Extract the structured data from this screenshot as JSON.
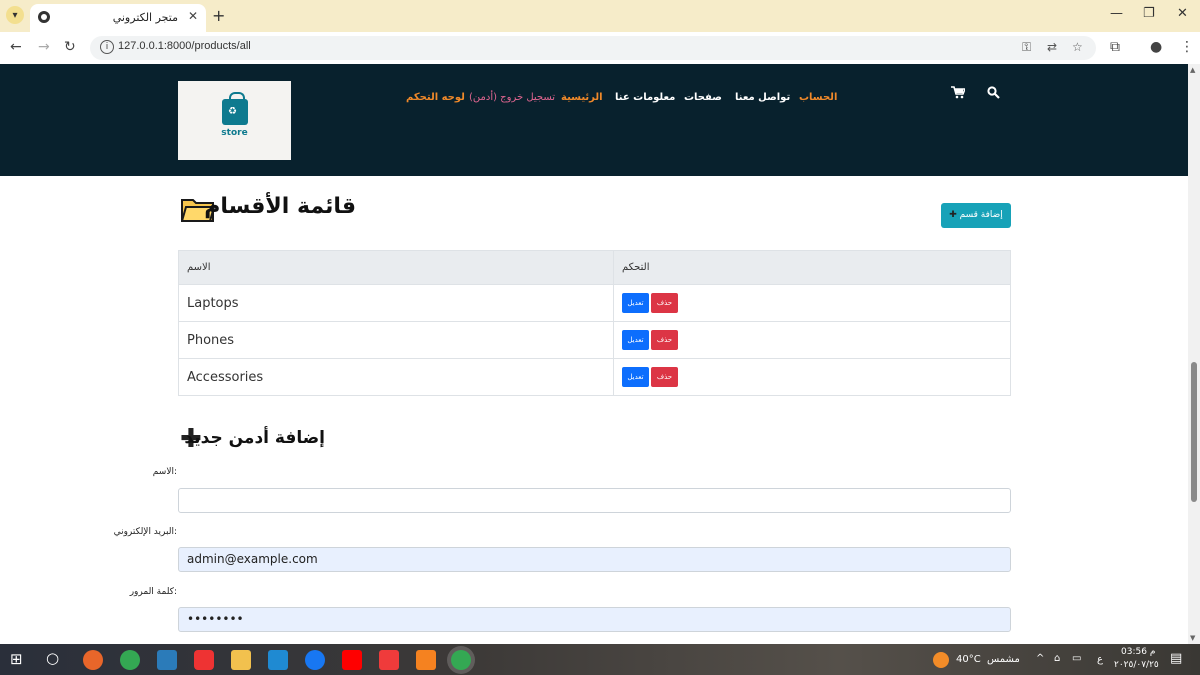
{
  "browser": {
    "tab_title": "متجر الكتروني",
    "url": "127.0.0.1:8000/products/all"
  },
  "header": {
    "logo_text": "store",
    "nav": [
      {
        "label": "لوحه التحكم"
      },
      {
        "label": "تسجيل خروج (أدمن)"
      },
      {
        "label": "الرئيسية"
      },
      {
        "label": "معلومات عنا"
      },
      {
        "label": "صفحات"
      },
      {
        "label": "تواصل معنا"
      },
      {
        "label": "الحساب"
      }
    ]
  },
  "categories": {
    "title": "قائمة الأقسام",
    "add_button": "إضافة قسم",
    "columns": {
      "name": "الاسم",
      "control": "التحكم"
    },
    "edit_label": "تعديل",
    "delete_label": "حذف",
    "rows": [
      {
        "name": "Laptops"
      },
      {
        "name": "Phones"
      },
      {
        "name": "Accessories"
      }
    ]
  },
  "admin_form": {
    "title": "إضافة أدمن جديد",
    "name_label": ":الاسم",
    "name_value": "",
    "email_label": ":البريد الإلكتروني",
    "email_value": "admin@example.com",
    "password_label": ":كلمة المرور",
    "password_value": "••••••••"
  },
  "taskbar": {
    "temperature": "40°C",
    "weather": "مشمس",
    "time": "03:56 م",
    "date": "٢٠٢٥/٠٧/٢٥",
    "lang": "ع"
  },
  "colors": {
    "header_bg": "#08212d",
    "nav_accent": "#f0892a",
    "logout": "#e06590",
    "info_button": "#17a2b8",
    "edit_button": "#0d6efd",
    "delete_button": "#dc3545"
  }
}
